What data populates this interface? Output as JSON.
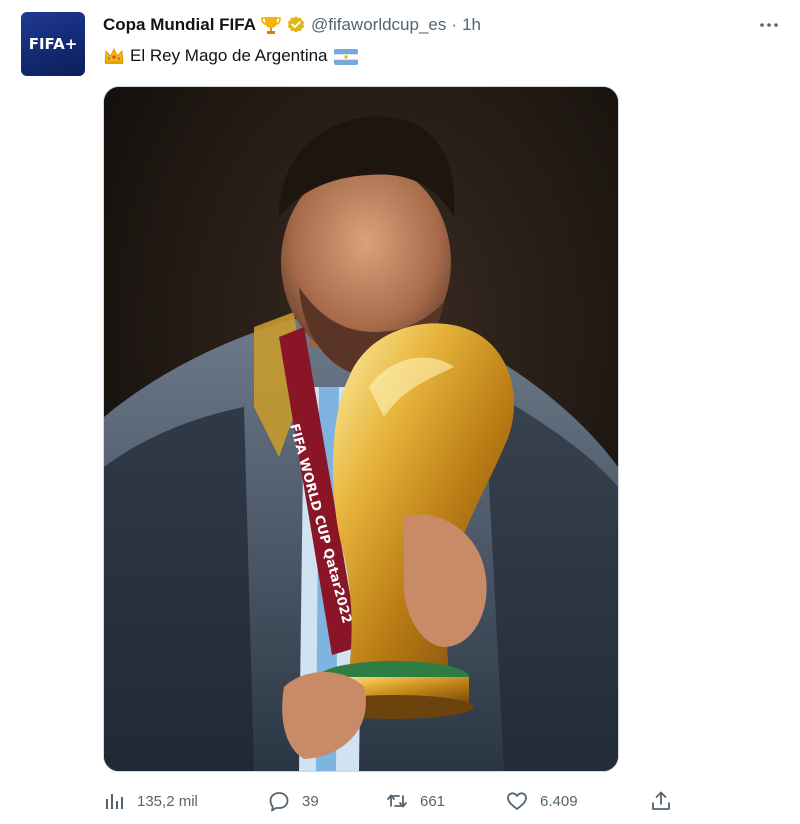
{
  "account": {
    "display_name": "Copa Mundial FIFA",
    "handle": "@fifaworldcup_es",
    "separator": "·",
    "time": "1h",
    "avatar_text": "FIFA+"
  },
  "tweet": {
    "text": "El Rey Mago de Argentina"
  },
  "media": {
    "medal_ribbon_text": "FIFA WORLD CUP Qatar2022"
  },
  "actions": {
    "views": "135,2 mil",
    "replies": "39",
    "retweets": "661",
    "likes": "6.409"
  },
  "colors": {
    "text": "#0f1419",
    "secondary": "#536471",
    "verified_badge": "#e2b719",
    "border": "#cfd9de"
  },
  "icons": {
    "trophy": "trophy-emoji-icon",
    "verified": "verified-badge-icon",
    "more": "more-options-icon",
    "crown": "crown-emoji-icon",
    "flag": "argentina-flag-icon",
    "views": "analytics-icon",
    "reply": "reply-icon",
    "retweet": "retweet-icon",
    "like": "heart-icon",
    "share": "share-icon"
  }
}
